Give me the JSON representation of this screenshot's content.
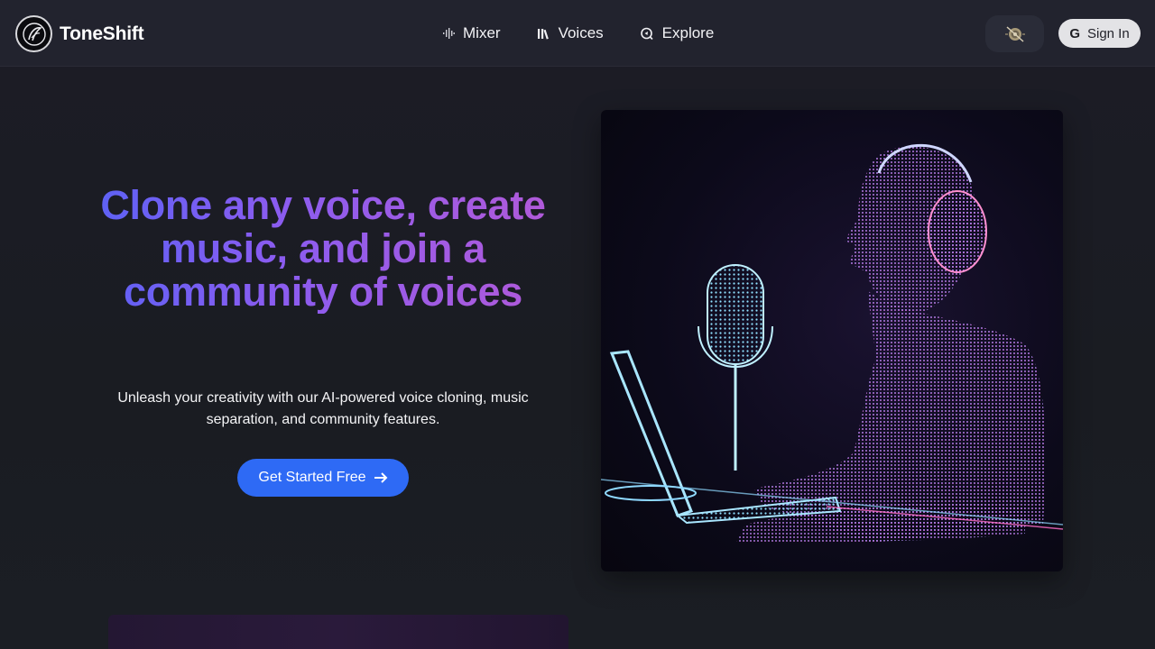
{
  "brand": {
    "name": "ToneShift"
  },
  "nav": [
    {
      "label": "Mixer",
      "icon": "waveform-icon"
    },
    {
      "label": "Voices",
      "icon": "library-icon"
    },
    {
      "label": "Explore",
      "icon": "explore-icon"
    }
  ],
  "header": {
    "signin_label": "Sign In",
    "theme_icon": "theme-toggle-icon"
  },
  "hero": {
    "title": "Clone any voice, create music, and join a community of voices",
    "subtitle": "Unleash your creativity with our AI-powered voice cloning, music separation, and community features.",
    "cta_label": "Get Started Free"
  },
  "colors": {
    "accent": "#2e6af5",
    "gradient_start": "#5a62f5",
    "gradient_end": "#b35ad8"
  }
}
